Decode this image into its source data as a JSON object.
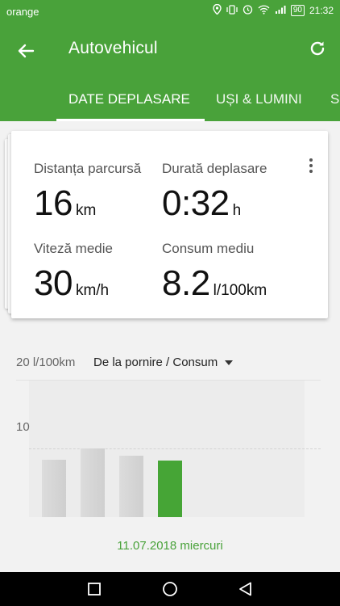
{
  "status_bar": {
    "carrier": "orange",
    "battery": "90",
    "time": "21:32"
  },
  "app_bar": {
    "title": "Autovehicul"
  },
  "tabs": [
    {
      "label": "DATE DEPLASARE",
      "active": true
    },
    {
      "label": "UȘI & LUMINI",
      "active": false
    },
    {
      "label": "S",
      "active": false
    }
  ],
  "metrics": [
    {
      "label": "Distanța parcursă",
      "value": "16",
      "unit": "km"
    },
    {
      "label": "Durată deplasare",
      "value": "0:32",
      "unit": "h"
    },
    {
      "label": "Viteză medie",
      "value": "30",
      "unit": "km/h"
    },
    {
      "label": "Consum mediu",
      "value": "8.2",
      "unit": "l/100km"
    }
  ],
  "chart": {
    "axis_top": "20 l/100km",
    "axis_mid": "10",
    "selector": "De la pornire / Consum",
    "date": "11.07.2018 miercuri"
  },
  "chart_data": {
    "type": "bar",
    "ylim": [
      0,
      20
    ],
    "values": [
      8.3,
      10,
      8.9,
      8.2
    ],
    "highlight_index": 3,
    "highlight_color": "#46a536"
  },
  "colors": {
    "accent": "#49a23a"
  }
}
